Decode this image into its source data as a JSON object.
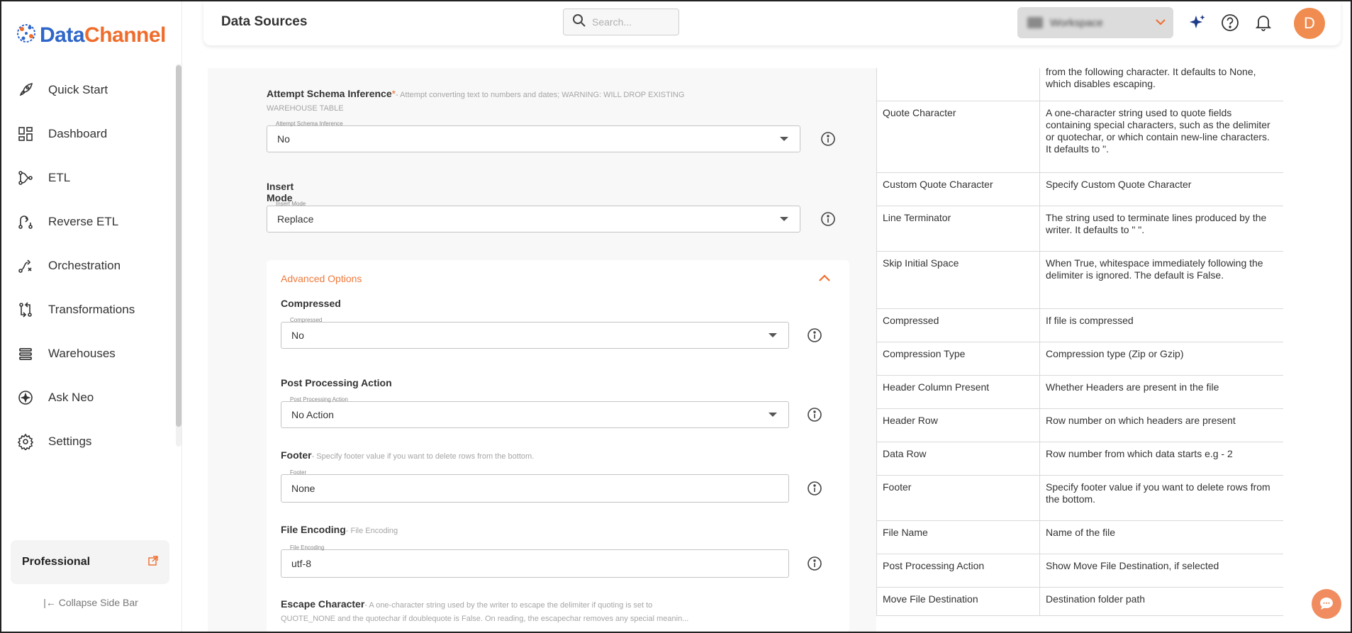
{
  "app": {
    "logo_text_1": "Data",
    "logo_text_2": "Channel"
  },
  "sidebar": {
    "items": [
      {
        "label": "Quick Start",
        "icon": "rocket-icon"
      },
      {
        "label": "Dashboard",
        "icon": "dashboard-icon"
      },
      {
        "label": "ETL",
        "icon": "etl-icon"
      },
      {
        "label": "Reverse ETL",
        "icon": "reverse-etl-icon"
      },
      {
        "label": "Orchestration",
        "icon": "orchestration-icon"
      },
      {
        "label": "Transformations",
        "icon": "transformations-icon"
      },
      {
        "label": "Warehouses",
        "icon": "warehouses-icon"
      },
      {
        "label": "Ask Neo",
        "icon": "ask-neo-icon"
      },
      {
        "label": "Settings",
        "icon": "gear-icon"
      }
    ],
    "plan_label": "Professional",
    "collapse_label": "Collapse Side Bar"
  },
  "header": {
    "title": "Data Sources",
    "search_placeholder": "Search...",
    "workspace_name": "Workspace",
    "avatar_initial": "D"
  },
  "form": {
    "schema_inference": {
      "label": "Attempt Schema Inference",
      "required_mark": "*",
      "hint_1": "- Attempt converting text to numbers and dates; WARNING: WILL DROP EXISTING",
      "hint_2": "WAREHOUSE TABLE",
      "legend": "Attempt Schema Inference",
      "value": "No"
    },
    "insert_mode": {
      "label": "Insert Mode",
      "legend": "Insert Mode",
      "value": "Replace"
    },
    "advanced_title": "Advanced Options",
    "compressed": {
      "label": "Compressed",
      "legend": "Compressed",
      "value": "No"
    },
    "post_processing": {
      "label": "Post Processing Action",
      "legend": "Post Processing Action",
      "value": "No Action"
    },
    "footer": {
      "label": "Footer",
      "hint": "- Specify footer value if you want to delete rows from the bottom.",
      "legend": "Footer",
      "value": "None"
    },
    "file_encoding": {
      "label": "File Encoding",
      "hint": "- File Encoding",
      "legend": "File Encoding",
      "value": "utf-8"
    },
    "escape_char": {
      "label": "Escape Character",
      "hint_1": "- A one-character string used by the writer to escape the delimiter if quoting is set to",
      "hint_2": "QUOTE_NONE and the quotechar if doublequote is False. On reading, the escapechar removes any special meanin..."
    }
  },
  "help_table": {
    "rows": [
      {
        "name": "",
        "desc": "from the following character. It defaults to None, which disables escaping."
      },
      {
        "name": "Quote Character",
        "desc": "A one-character string used to quote fields containing special characters, such as the delimiter or quotechar, or which contain new-line characters. It defaults to \"."
      },
      {
        "name": "Custom Quote Character",
        "desc": "Specify Custom Quote Character"
      },
      {
        "name": "Line Terminator",
        "desc": "The string used to terminate lines produced by the writer. It defaults to \" \"."
      },
      {
        "name": "Skip Initial Space",
        "desc": "When True, whitespace immediately following the delimiter is ignored. The default is False."
      },
      {
        "name": "Compressed",
        "desc": "If file is compressed"
      },
      {
        "name": "Compression Type",
        "desc": "Compression type (Zip or Gzip)"
      },
      {
        "name": "Header Column Present",
        "desc": "Whether Headers are present in the file"
      },
      {
        "name": "Header Row",
        "desc": "Row number on which headers are present"
      },
      {
        "name": "Data Row",
        "desc": "Row number from which data starts e.g - 2"
      },
      {
        "name": "Footer",
        "desc": "Specify footer value if you want to delete rows from the bottom."
      },
      {
        "name": "File Name",
        "desc": "Name of the file"
      },
      {
        "name": "Post Processing Action",
        "desc": "Show Move File Destination, if selected"
      },
      {
        "name": "Move File Destination",
        "desc": "Destination folder path"
      }
    ]
  },
  "colors": {
    "brand_blue": "#2f66c9",
    "accent_orange": "#ef6d2c",
    "avatar": "#f08c50"
  }
}
